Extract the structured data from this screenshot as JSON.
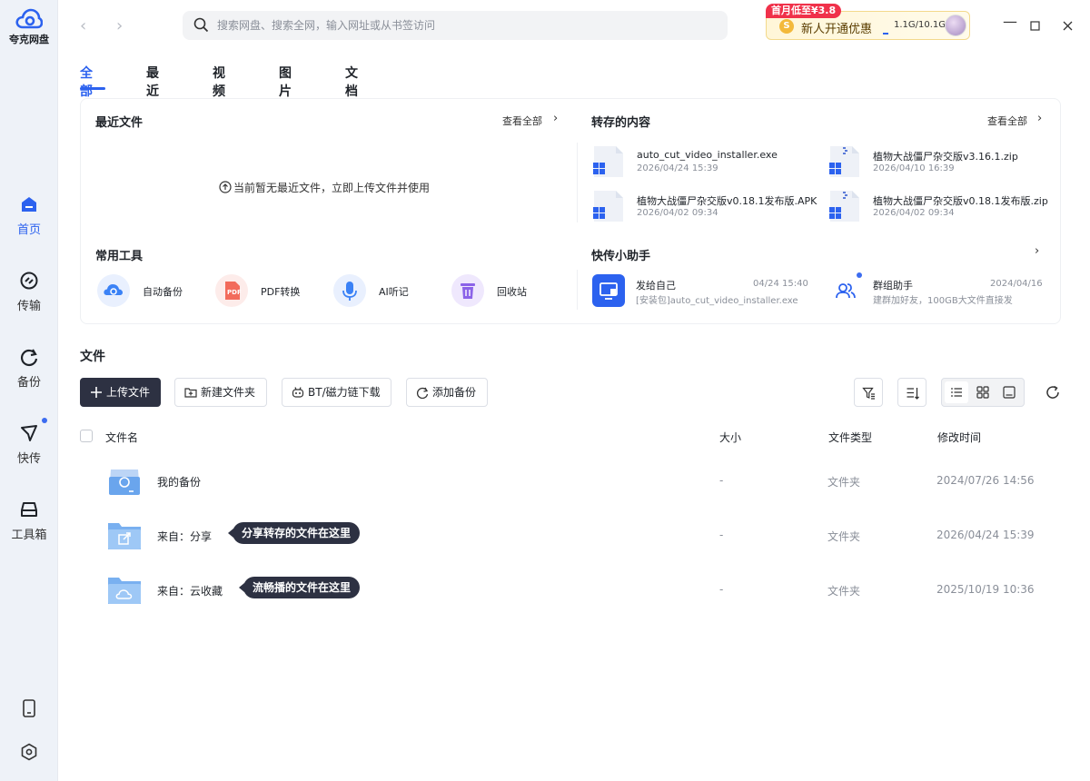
{
  "app": {
    "logo_text": "夸克网盘"
  },
  "sidebar": {
    "items": [
      {
        "label": "首页",
        "icon": "home-icon",
        "active": true
      },
      {
        "label": "传输",
        "icon": "transfer-icon"
      },
      {
        "label": "备份",
        "icon": "backup-icon"
      },
      {
        "label": "快传",
        "icon": "send-icon",
        "badge": true
      },
      {
        "label": "工具箱",
        "icon": "toolbox-icon"
      }
    ],
    "bottom_icons": [
      "phone-icon",
      "settings-icon"
    ]
  },
  "topbar": {
    "search_placeholder": "搜索网盘、搜索全网，输入网址或从书签访问",
    "vip_badge": "首月低至¥3.8",
    "vip_promo": "新人开通优惠",
    "storage": "1.1G/10.1G"
  },
  "tabs": [
    "全部",
    "最近",
    "视频",
    "图片",
    "文档"
  ],
  "recent": {
    "title": "最近文件",
    "see_all": "查看全部",
    "empty_tip": "当前暂无最近文件，立即上传文件并使用"
  },
  "saved": {
    "title": "转存的内容",
    "see_all": "查看全部",
    "items": [
      {
        "name": "auto_cut_video_installer.exe",
        "time": "2026/04/24 15:39",
        "type": "exe"
      },
      {
        "name": "植物大战僵尸杂交版v3.16.1.zip",
        "time": "2026/04/10 16:39",
        "type": "zip"
      },
      {
        "name": "植物大战僵尸杂交版v0.18.1发布版.APK",
        "time": "2026/04/02 09:34",
        "type": "apk"
      },
      {
        "name": "植物大战僵尸杂交版v0.18.1发布版.zip",
        "time": "2026/04/02 09:34",
        "type": "zip"
      }
    ]
  },
  "tools": {
    "title": "常用工具",
    "items": [
      {
        "label": "自动备份",
        "icon": "auto-backup-icon",
        "color": "#3b82f6"
      },
      {
        "label": "PDF转换",
        "icon": "pdf-icon",
        "color": "#f26b5b"
      },
      {
        "label": "AI听记",
        "icon": "microphone-icon",
        "color": "#3b82f6"
      },
      {
        "label": "回收站",
        "icon": "trash-icon",
        "color": "#8b63e8"
      }
    ]
  },
  "quick": {
    "title": "快传小助手",
    "items": [
      {
        "title": "发给自己",
        "subtitle": "[安装包]auto_cut_video_installer.exe",
        "time": "04/24 15:40"
      },
      {
        "title": "群组助手",
        "subtitle": "建群加好友，100GB大文件直接发",
        "time": "2024/04/16"
      }
    ]
  },
  "files": {
    "title": "文件",
    "buttons": {
      "upload": "上传文件",
      "new_folder": "新建文件夹",
      "bt_download": "BT/磁力链下载",
      "add_backup": "添加备份"
    },
    "columns": {
      "name": "文件名",
      "size": "大小",
      "type": "文件类型",
      "modified": "修改时间"
    },
    "rows": [
      {
        "name": "我的备份",
        "size": "-",
        "type": "文件夹",
        "modified": "2024/07/26 14:56",
        "tip": ""
      },
      {
        "name": "来自：分享",
        "size": "-",
        "type": "文件夹",
        "modified": "2026/04/24 15:39",
        "tip": "分享转存的文件在这里"
      },
      {
        "name": "来自：云收藏",
        "size": "-",
        "type": "文件夹",
        "modified": "2025/10/19 10:36",
        "tip": "流畅播的文件在这里"
      }
    ]
  },
  "colors": {
    "accent": "#2c62ef",
    "dark_button": "#2d3142",
    "badge_red": "#f0314a"
  }
}
